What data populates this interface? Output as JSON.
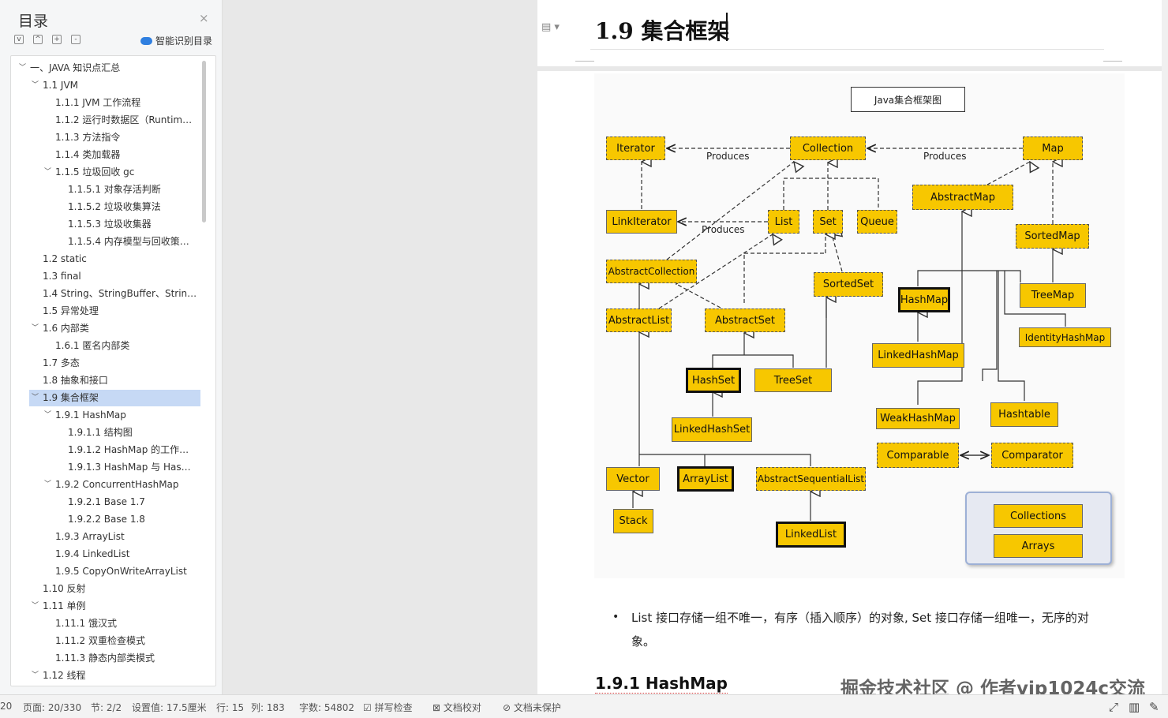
{
  "toc": {
    "title": "目录",
    "smart_label": "智能识别目录",
    "close_icon": "×",
    "items": [
      {
        "label": "一、JAVA 知识点汇总",
        "level": 0,
        "arrow": "﹀"
      },
      {
        "label": "1.1 JVM",
        "level": 1,
        "arrow": "﹀"
      },
      {
        "label": "1.1.1 JVM  工作流程",
        "level": 2,
        "arrow": ""
      },
      {
        "label": "1.1.2  运行时数据区（Runtim…",
        "level": 2,
        "arrow": ""
      },
      {
        "label": "1.1.3  方法指令",
        "level": 2,
        "arrow": ""
      },
      {
        "label": "1.1.4  类加载器",
        "level": 2,
        "arrow": ""
      },
      {
        "label": "1.1.5  垃圾回收  gc",
        "level": 2,
        "arrow": "﹀"
      },
      {
        "label": "1.1.5.1  对象存活判断",
        "level": 3,
        "arrow": ""
      },
      {
        "label": "1.1.5.2  垃圾收集算法",
        "level": 3,
        "arrow": ""
      },
      {
        "label": "1.1.5.3  垃圾收集器",
        "level": 3,
        "arrow": ""
      },
      {
        "label": "1.1.5.4  内存模型与回收策…",
        "level": 3,
        "arrow": ""
      },
      {
        "label": "1.2 static",
        "level": 1,
        "arrow": ""
      },
      {
        "label": "1.3 final",
        "level": 1,
        "arrow": ""
      },
      {
        "label": "1.4 String、StringBuffer、Strin…",
        "level": 1,
        "arrow": ""
      },
      {
        "label": "1.5  异常处理",
        "level": 1,
        "arrow": ""
      },
      {
        "label": "1.6  内部类",
        "level": 1,
        "arrow": "﹀"
      },
      {
        "label": "1.6.1  匿名内部类",
        "level": 2,
        "arrow": ""
      },
      {
        "label": "1.7  多态",
        "level": 1,
        "arrow": ""
      },
      {
        "label": "1.8  抽象和接口",
        "level": 1,
        "arrow": ""
      },
      {
        "label": "1.9  集合框架",
        "level": 1,
        "arrow": "﹀",
        "active": true
      },
      {
        "label": "1.9.1 HashMap",
        "level": 2,
        "arrow": "﹀"
      },
      {
        "label": "1.9.1.1  结构图",
        "level": 3,
        "arrow": ""
      },
      {
        "label": "1.9.1.2 HashMap  的工作…",
        "level": 3,
        "arrow": ""
      },
      {
        "label": "1.9.1.3 HashMap  与  Has…",
        "level": 3,
        "arrow": ""
      },
      {
        "label": "1.9.2 ConcurrentHashMap",
        "level": 2,
        "arrow": "﹀"
      },
      {
        "label": "1.9.2.1 Base 1.7",
        "level": 3,
        "arrow": ""
      },
      {
        "label": "1.9.2.2 Base 1.8",
        "level": 3,
        "arrow": ""
      },
      {
        "label": "1.9.3 ArrayList",
        "level": 2,
        "arrow": ""
      },
      {
        "label": "1.9.4 LinkedList",
        "level": 2,
        "arrow": ""
      },
      {
        "label": "1.9.5 CopyOnWriteArrayList",
        "level": 2,
        "arrow": ""
      },
      {
        "label": "1.10  反射",
        "level": 1,
        "arrow": ""
      },
      {
        "label": "1.11  单例",
        "level": 1,
        "arrow": "﹀"
      },
      {
        "label": "1.11.1  饿汉式",
        "level": 2,
        "arrow": ""
      },
      {
        "label": "1.11.2  双重检查模式",
        "level": 2,
        "arrow": ""
      },
      {
        "label": "1.11.3  静态内部类模式",
        "level": 2,
        "arrow": ""
      },
      {
        "label": "1.12  线程",
        "level": 1,
        "arrow": "﹀"
      }
    ]
  },
  "doc": {
    "heading": "1.9  集合框架",
    "diagram_title": "Java集合框架图",
    "nodes": {
      "iterator": "Iterator",
      "collection": "Collection",
      "map": "Map",
      "abstract_map": "AbstractMap",
      "linkiterator": "LinkIterator",
      "list": "List",
      "set": "Set",
      "queue": "Queue",
      "sorted_map": "SortedMap",
      "abstract_collection": "AbstractCollection",
      "sorted_set": "SortedSet",
      "hash_map": "HashMap",
      "tree_map": "TreeMap",
      "abstract_list": "AbstractList",
      "abstract_set": "AbstractSet",
      "identity_hash_map": "IdentityHashMap",
      "linked_hash_map": "LinkedHashMap",
      "hash_set": "HashSet",
      "tree_set": "TreeSet",
      "weak_hash_map": "WeakHashMap",
      "hashtable": "Hashtable",
      "linked_hash_set": "LinkedHashSet",
      "comparable": "Comparable",
      "comparator": "Comparator",
      "vector": "Vector",
      "array_list": "ArrayList",
      "abstract_sequential_list": "AbstractSequentialList",
      "stack": "Stack",
      "linked_list": "LinkedList",
      "collections": "Collections",
      "arrays": "Arrays"
    },
    "produces_1": "Produces",
    "produces_2": "Produces",
    "produces_3": "Produces",
    "bullet": "List 接口存储一组不唯一，有序（插入顺序）的对象, Set 接口存储一组唯一，无序的对象。",
    "subheading": "1.9.1 HashMap",
    "watermark": "掘金技术社区 @ 作者vip1024c交流"
  },
  "status": {
    "page_num": "20",
    "page": "页面: 20/330",
    "section": "节: 2/2",
    "setting": "设置值: 17.5厘米",
    "row": "行: 15",
    "col": "列: 183",
    "words": "字数: 54802",
    "spell": "拼写检查",
    "proof": "文档校对",
    "protect": "文档未保护"
  },
  "colors": {
    "node_fill": "#f7c700",
    "toc_active": "#c6d9f5"
  }
}
